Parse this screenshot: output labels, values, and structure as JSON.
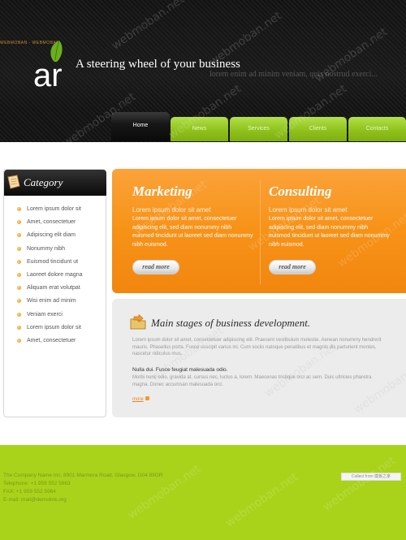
{
  "header": {
    "small_tag": "WEBMOBAN - WEBMOBAN",
    "logo_text": "ar",
    "tagline": "A steering wheel of your business",
    "subline": "lorem enim ad minim veniam, quis nostrud exerci..."
  },
  "nav": {
    "items": [
      {
        "label": "Home",
        "active": true
      },
      {
        "label": "News",
        "active": false
      },
      {
        "label": "Services",
        "active": false
      },
      {
        "label": "Clients",
        "active": false
      },
      {
        "label": "Contacts",
        "active": false
      }
    ]
  },
  "sidebar": {
    "title": "Category",
    "items": [
      "Lorem ipsum dolor sit",
      "Amet, consectetuer",
      "Adipiscing elit diam",
      "Nonummy nibh",
      "Euismod tincidunt ut",
      "Laoreet dolore magna",
      "Aliquam erat volutpat",
      "Wisi enim ad minim",
      "Veniam exerci",
      "Lorem ipsum dolor sit",
      "Amet, consectetuer"
    ]
  },
  "features": [
    {
      "title": "Marketing",
      "subtitle": "Lorem ipsum dolor sit amet",
      "text": "Lorem ipsum dolor sit amet, consectetuer adipiscing elit, sed diam nonummy nibh euismod tincidunt ut laoreet sed diam nonummy nibh euismod.",
      "button": "read more"
    },
    {
      "title": "Consulting",
      "subtitle": "Lorem ipsum dolor sit amet",
      "text": "Lorem ipsum dolor sit amet, consectetuer adipiscing elit, sed diam nonummy nibh euismod tincidunt ut laoreet sed diam nonummy nibh euismod.",
      "button": "read more"
    }
  ],
  "stages": {
    "title": "Main stages of business development.",
    "text": "Lorem ipsum dolor sit amet, consectetuer adipiscing elit. Praesent vestibulum molestie. Aenean nonummy hendrerit mauris. Phasellus porta. Fusce suscipit varius mi. Cum sociis natoque penatibus et magnis dis parturient montes, nascetur ridiculus mus.",
    "strong": "Nulla dui. Fusce feugiat malesuada odio.",
    "text2": "Morbi nunc odio, gravida at, cursus nec, luctus a, lorem. Maecenas tristique orci ac sem. Duis ultricies pharetra magna. Donec accumsan malesuada orci.",
    "more": "more"
  },
  "footer": {
    "line1": "The Company Name Inc. 8901 Marmora Road, Glasgow, D04 89GR",
    "line2": "Telephone: +1 959 552 5963",
    "line3": "FAX: +1 959 552 5964",
    "email_label": "E-mail: ",
    "email": "mail@demolink.org",
    "badge": "Collect from 模板之家"
  },
  "watermark": "webmoban.net",
  "colors": {
    "accent_green": "#a9d31b",
    "accent_orange": "#f79217",
    "header_dark": "#161616"
  }
}
